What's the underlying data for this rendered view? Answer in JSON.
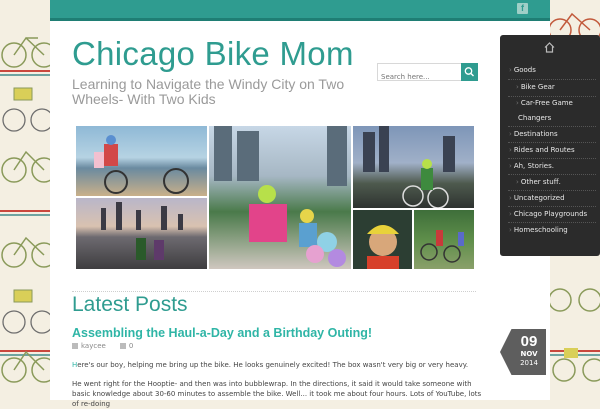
{
  "header": {
    "site_title": "Chicago Bike Mom",
    "tagline": "Learning to Navigate the Windy City on Two Wheels- With Two Kids",
    "facebook_icon_label": "f"
  },
  "search": {
    "placeholder": "Search here..."
  },
  "collage": {
    "photos": [
      "family-bike-beach",
      "city-skyline-riders",
      "evening-bike-ride",
      "lakefront-skyline",
      "kids-bike-group",
      "woman-helmet-selfie",
      "park-bikes"
    ]
  },
  "content": {
    "section_heading": "Latest Posts",
    "post": {
      "title": "Assembling the Haul-a-Day and a Birthday Outing!",
      "author": "kaycee",
      "comments": "0",
      "para1_first_letter": "H",
      "para1_rest": "ere's our boy, helping me bring up the bike.  He looks genuinely excited!  The box wasn't very big or very heavy.",
      "para2": "He went right for the Hooptie- and then was into bubblewrap.  In the directions, it said it would take someone with basic knowledge about 30-60 minutes to assemble the bike.  Well... it took me about four hours.  Lots of YouTube, lots of re-doing"
    },
    "date_badge": {
      "day": "09",
      "month": "NOV",
      "year": "2014"
    }
  },
  "sidebar": {
    "items": [
      {
        "label": "Goods",
        "level": 0
      },
      {
        "label": "Bike Gear",
        "level": 1
      },
      {
        "label": "Car-Free Game",
        "level": 1
      },
      {
        "label": "Changers",
        "level": 0
      },
      {
        "label": "Destinations",
        "level": 0
      },
      {
        "label": "Rides and Routes",
        "level": 0
      },
      {
        "label": "Ah, Stories.",
        "level": 0
      },
      {
        "label": "Other stuff.",
        "level": 1
      },
      {
        "label": "Uncategorized",
        "level": 0
      },
      {
        "label": "Chicago Playgrounds",
        "level": 0
      },
      {
        "label": "Homeschooling",
        "level": 0
      }
    ]
  },
  "colors": {
    "accent": "#2f9c90",
    "link": "#2fb5a6",
    "sidebar_bg": "#2b2b2b",
    "badge_bg": "#5e5e5e"
  }
}
